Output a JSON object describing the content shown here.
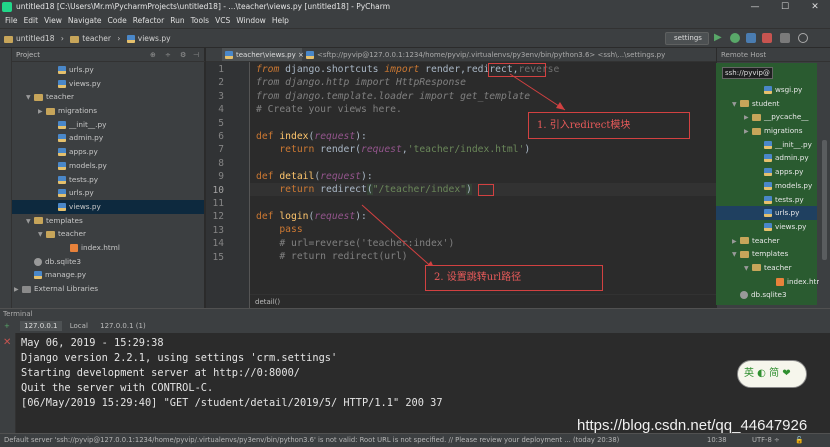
{
  "window": {
    "title": "untitled18 [C:\\Users\\Mr.m\\PycharmProjects\\untitled18] - ...\\teacher\\views.py [untitled18] - PyCharm",
    "minimize": "—",
    "maximize": "☐",
    "close": "✕"
  },
  "menu": [
    "File",
    "Edit",
    "View",
    "Navigate",
    "Code",
    "Refactor",
    "Run",
    "Tools",
    "VCS",
    "Window",
    "Help"
  ],
  "nav": {
    "crumbs": [
      "untitled18",
      "teacher",
      "views.py"
    ],
    "run_config": "settings"
  },
  "project": {
    "header": "Project",
    "items": [
      {
        "label": "urls.py",
        "type": "py",
        "indent": 3
      },
      {
        "label": "views.py",
        "type": "py",
        "indent": 3
      },
      {
        "label": "teacher",
        "type": "folder",
        "indent": 1,
        "arrow": "▼"
      },
      {
        "label": "migrations",
        "type": "folder",
        "indent": 2,
        "arrow": "▶"
      },
      {
        "label": "__init__.py",
        "type": "py",
        "indent": 3
      },
      {
        "label": "admin.py",
        "type": "py",
        "indent": 3
      },
      {
        "label": "apps.py",
        "type": "py",
        "indent": 3
      },
      {
        "label": "models.py",
        "type": "py",
        "indent": 3
      },
      {
        "label": "tests.py",
        "type": "py",
        "indent": 3
      },
      {
        "label": "urls.py",
        "type": "py",
        "indent": 3
      },
      {
        "label": "views.py",
        "type": "py",
        "indent": 3,
        "selected": true
      },
      {
        "label": "templates",
        "type": "folder",
        "indent": 1,
        "arrow": "▼"
      },
      {
        "label": "teacher",
        "type": "folder",
        "indent": 2,
        "arrow": "▼"
      },
      {
        "label": "index.html",
        "type": "html",
        "indent": 4
      },
      {
        "label": "db.sqlite3",
        "type": "db",
        "indent": 1
      },
      {
        "label": "manage.py",
        "type": "py",
        "indent": 1
      },
      {
        "label": "External Libraries",
        "type": "lib",
        "indent": 0,
        "arrow": "▶"
      }
    ]
  },
  "editor": {
    "active_tab": "teacher\\views.py",
    "other_tab": "<sftp://pyvip@127.0.0.1:1234/home/pyvip/.virtualenvs/py3env/bin/python3.6> <ssh\\...\\settings.py",
    "line_numbers": [
      "1",
      "2",
      "3",
      "4",
      "5",
      "6",
      "7",
      "8",
      "9",
      "10",
      "11",
      "12",
      "13",
      "14",
      "15"
    ],
    "breadcrumb": "detail()"
  },
  "annotations": {
    "first": "1. 引入redirect模块",
    "second": "2. 设置跳转url路径"
  },
  "remote": {
    "header": "Remote Host",
    "host": "ssh://pyvip@",
    "items": [
      {
        "label": "wsgi.py",
        "type": "py",
        "indent": 3
      },
      {
        "label": "student",
        "type": "folder",
        "indent": 1,
        "arrow": "▼"
      },
      {
        "label": "__pycache__",
        "type": "folder",
        "indent": 2,
        "arrow": "▶"
      },
      {
        "label": "migrations",
        "type": "folder",
        "indent": 2,
        "arrow": "▶"
      },
      {
        "label": "__init__.py",
        "type": "py",
        "indent": 3
      },
      {
        "label": "admin.py",
        "type": "py",
        "indent": 3
      },
      {
        "label": "apps.py",
        "type": "py",
        "indent": 3
      },
      {
        "label": "models.py",
        "type": "py",
        "indent": 3
      },
      {
        "label": "tests.py",
        "type": "py",
        "indent": 3
      },
      {
        "label": "urls.py",
        "type": "py",
        "indent": 3,
        "selected": true
      },
      {
        "label": "views.py",
        "type": "py",
        "indent": 3
      },
      {
        "label": "teacher",
        "type": "folder",
        "indent": 1,
        "arrow": "▶"
      },
      {
        "label": "templates",
        "type": "folder",
        "indent": 1,
        "arrow": "▼"
      },
      {
        "label": "teacher",
        "type": "folder",
        "indent": 2,
        "arrow": "▼"
      },
      {
        "label": "index.html",
        "type": "html",
        "indent": 4
      },
      {
        "label": "db.sqlite3",
        "type": "db",
        "indent": 1
      }
    ]
  },
  "terminal": {
    "header": "Terminal",
    "tabs": [
      "127.0.0.1",
      "Local",
      "127.0.0.1 (1)"
    ],
    "lines": [
      "May 06, 2019 - 15:29:38",
      "Django version 2.2.1, using settings 'crm.settings'",
      "Starting development server at http://0:8000/",
      "Quit the server with CONTROL-C.",
      "[06/May/2019 15:29:40] \"GET /student/detail/2019/5/ HTTP/1.1\" 200 37"
    ]
  },
  "watermark": "https://blog.csdn.net/qq_44647926",
  "sticker": "英 ◐ 简 ❤",
  "status": {
    "message": "Default server 'ssh://pyvip@127.0.0.1:1234/home/pyvip/.virtualenvs/py3env/bin/python3.6' is not valid: Root URL is not specified. // Please review your deployment ... (today 20:38)",
    "position": "10:38",
    "encoding": "UTF-8 ÷"
  },
  "colors": {
    "keyword": "#cc7832",
    "function": "#ffc66d",
    "string": "#6a8759",
    "comment": "#808080",
    "annotation": "#d24141",
    "remote_bg": "#2a5b30"
  }
}
